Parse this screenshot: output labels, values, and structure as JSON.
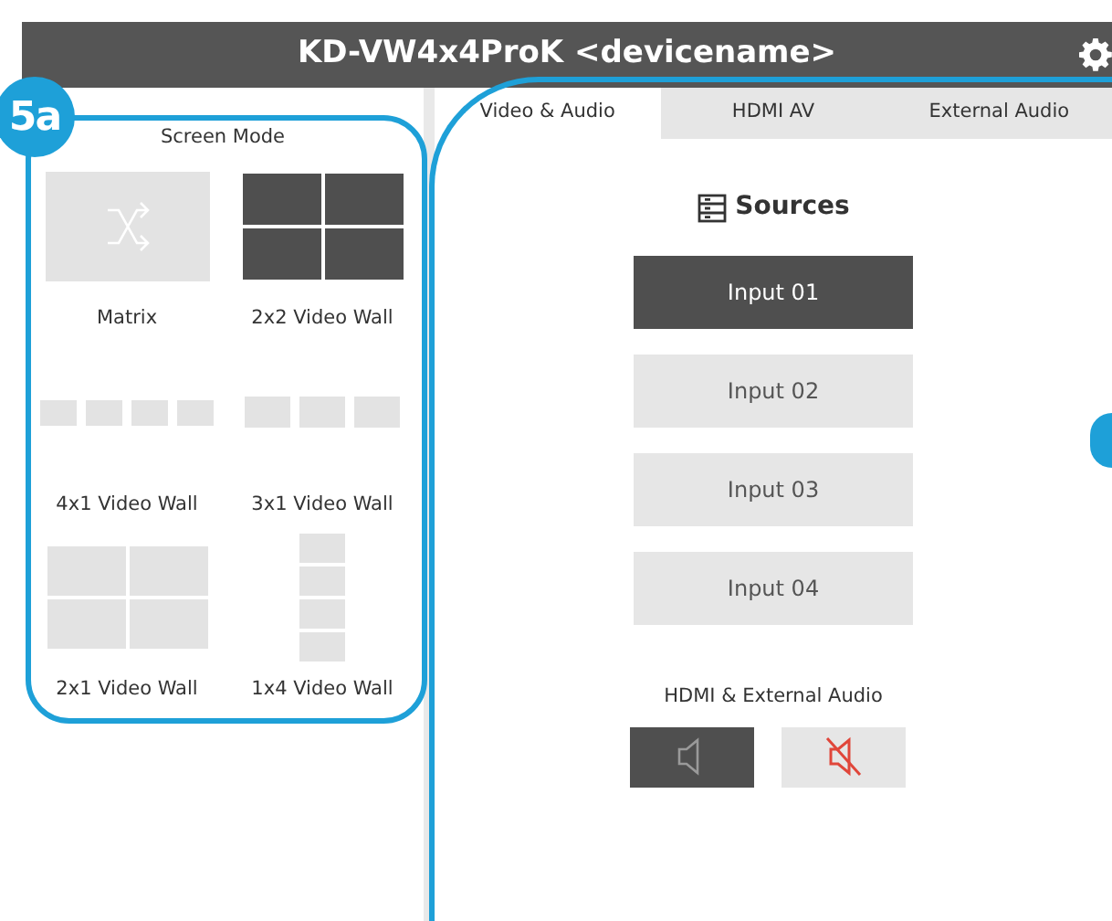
{
  "window": {
    "title": "KD-VW4x4ProK <devicename>"
  },
  "callout": {
    "label": "5a"
  },
  "screen_mode": {
    "title": "Screen Mode",
    "modes": [
      {
        "label": "Matrix",
        "kind": "matrix",
        "selected": false
      },
      {
        "label": "2x2 Video Wall",
        "kind": "quad",
        "selected": true
      },
      {
        "label": "4x1 Video Wall",
        "kind": "row4",
        "selected": false
      },
      {
        "label": "3x1 Video Wall",
        "kind": "row3",
        "selected": false
      },
      {
        "label": "2x1 Video Wall",
        "kind": "halves",
        "selected": false
      },
      {
        "label": "1x4 Video Wall",
        "kind": "column4",
        "selected": false
      }
    ]
  },
  "tabs": [
    {
      "label": "Video & Audio",
      "selected": true
    },
    {
      "label": "HDMI AV",
      "selected": false
    },
    {
      "label": "External Audio",
      "selected": false
    }
  ],
  "sources": {
    "title": "Sources",
    "inputs": [
      {
        "label": "Input 01",
        "selected": true
      },
      {
        "label": "Input 02",
        "selected": false
      },
      {
        "label": "Input 03",
        "selected": false
      },
      {
        "label": "Input 04",
        "selected": false
      }
    ]
  },
  "audio": {
    "title": "HDMI & External Audio",
    "buttons": [
      {
        "kind": "unmute",
        "selected": true
      },
      {
        "kind": "mute",
        "selected": false
      }
    ]
  }
}
